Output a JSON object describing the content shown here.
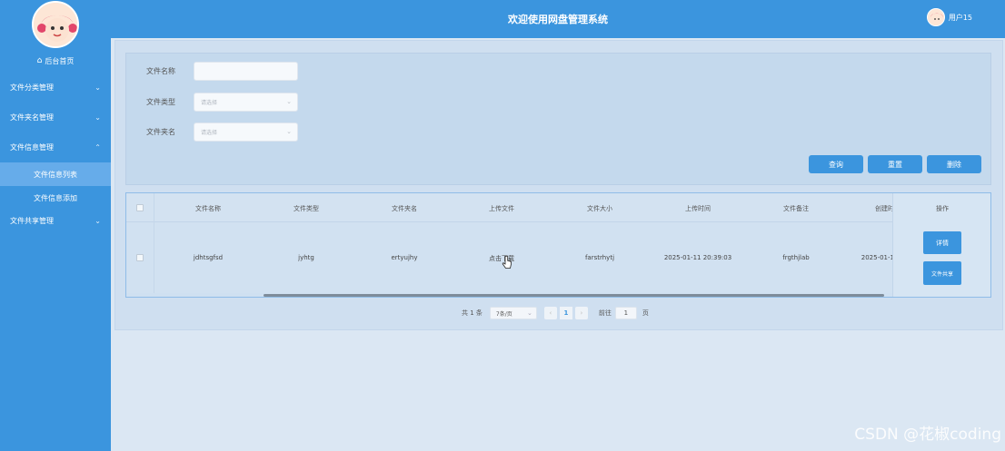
{
  "app": {
    "title": "欢迎使用网盘管理系统"
  },
  "user": {
    "name": "用户15"
  },
  "sidebar": {
    "home": "后台首页",
    "menus": [
      {
        "label": "文件分类管理"
      },
      {
        "label": "文件夹名管理"
      },
      {
        "label": "文件信息管理"
      }
    ],
    "submenus": [
      {
        "label": "文件信息列表"
      },
      {
        "label": "文件信息添加"
      }
    ],
    "menu_last": {
      "label": "文件共享管理"
    }
  },
  "search": {
    "file_name_label": "文件名称",
    "file_type_label": "文件类型",
    "folder_name_label": "文件夹名",
    "select_placeholder": "请选择",
    "query_button": "查询",
    "reset_button": "重置",
    "delete_button": "删除"
  },
  "table": {
    "columns": [
      "文件名称",
      "文件类型",
      "文件夹名",
      "上传文件",
      "文件大小",
      "上传时间",
      "文件备注",
      "创建时",
      "操作"
    ],
    "rows": [
      {
        "file_name": "jdhtsgfsd",
        "file_type": "jyhtg",
        "folder_name": "ertyujhy",
        "upload_file": "点击下载",
        "file_size": "farstrhytj",
        "upload_time": "2025-01-11 20:39:03",
        "remark": "frgthjlab",
        "created": "2025-01-1",
        "detail_button": "详情",
        "share_button": "文件共享"
      }
    ]
  },
  "pagination": {
    "total": "共 1 条",
    "page_size": "7条/页",
    "current_page": "1",
    "goto_label": "前往",
    "goto_value": "1",
    "page_suffix": "页"
  },
  "watermark": "CSDN @花椒coding",
  "colors": {
    "primary": "#3b95de",
    "link": "#2f7fd6"
  }
}
